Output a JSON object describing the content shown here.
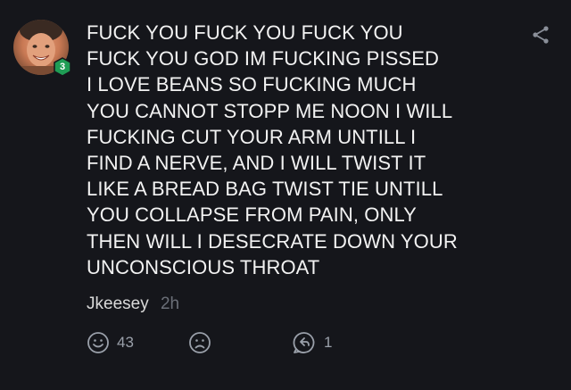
{
  "comment": {
    "level_badge": "3",
    "lines": [
      "FUCK YOU FUCK YOU FUCK YOU",
      "FUCK YOU GOD IM FUCKING PISSED",
      "I LOVE BEANS SO FUCKING MUCH",
      "YOU CANNOT STOPP ME NOON I WILL",
      "FUCKING CUT YOUR ARM UNTILL I",
      "FIND A NERVE, AND I WILL TWIST IT",
      "LIKE A BREAD BAG TWIST TIE UNTILL",
      "YOU COLLAPSE FROM PAIN, ONLY",
      "THEN WILL I DESECRATE DOWN YOUR",
      "UNCONSCIOUS THROAT"
    ],
    "username": "Jkeesey",
    "timestamp": "2h"
  },
  "actions": {
    "like_icon": "smiley-face-icon",
    "like_count": "43",
    "dislike_icon": "frown-face-icon",
    "reply_icon": "reply-bubble-icon",
    "reply_count": "1",
    "share_icon": "share-icon"
  },
  "colors": {
    "background": "#15161b",
    "text": "#f2f2f2",
    "muted": "#6b6f78",
    "badge_green": "#1f9d55"
  }
}
